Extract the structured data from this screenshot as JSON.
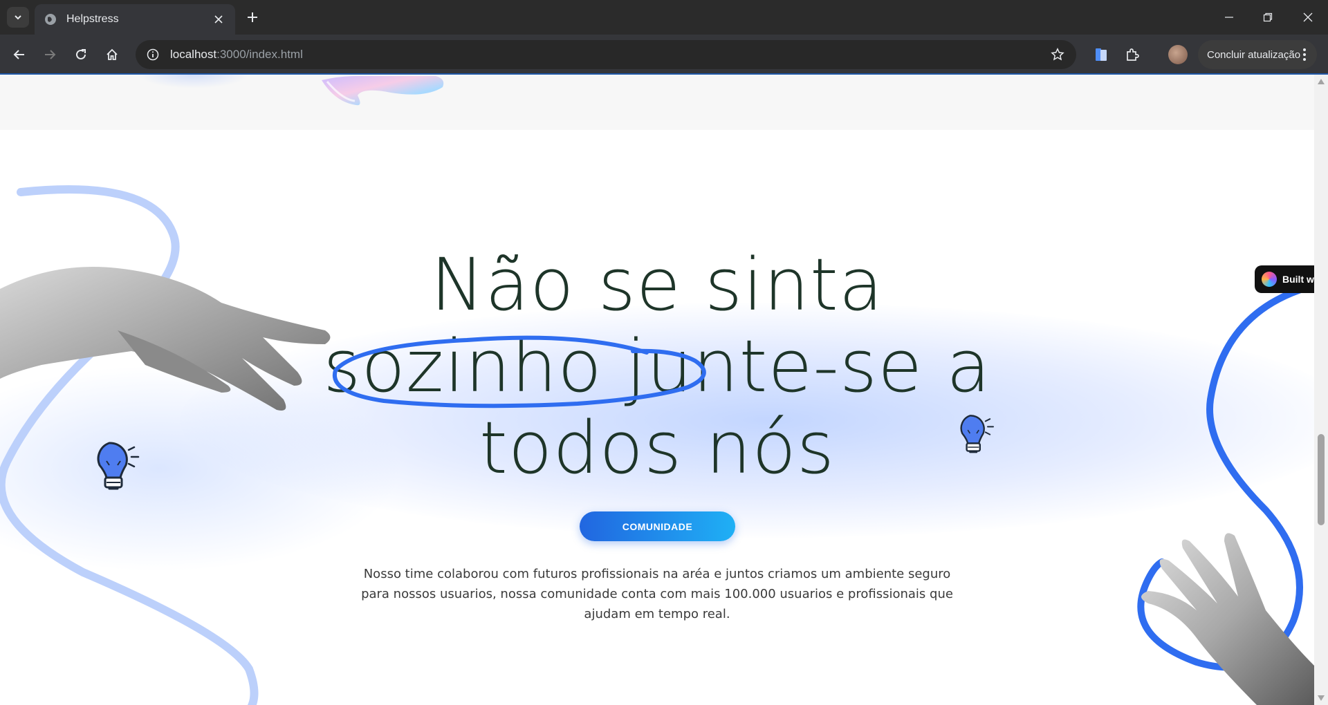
{
  "browser": {
    "tab_title": "Helpstress",
    "url_host": "localhost",
    "url_path": ":3000/index.html",
    "update_button": "Concluir atualização"
  },
  "page": {
    "heading_lines": [
      "Não se sinta",
      "sozinho junte-se a",
      "todos nós"
    ],
    "cta_label": "COMUNIDADE",
    "description": "Nosso time colaborou com futuros profissionais na aréa e juntos criamos um ambiente seguro para nossos usuarios, nossa comunidade conta com mais 100.000 usuarios e profissionais que ajudam em tempo real.",
    "badge_label": "Built wi"
  },
  "colors": {
    "accent_blue": "#2f6df0",
    "light_blue": "#bcd0fb",
    "heading_color": "#1e3529"
  },
  "icons": [
    "tab-list-icon",
    "globe-icon",
    "close-icon",
    "plus-icon",
    "minimize-icon",
    "restore-icon",
    "window-close-icon",
    "back-icon",
    "forward-icon",
    "reload-icon",
    "home-icon",
    "info-icon",
    "star-icon",
    "document-extension-icon",
    "puzzle-icon",
    "kebab-menu-icon",
    "lightbulb-icon",
    "hand-image"
  ]
}
